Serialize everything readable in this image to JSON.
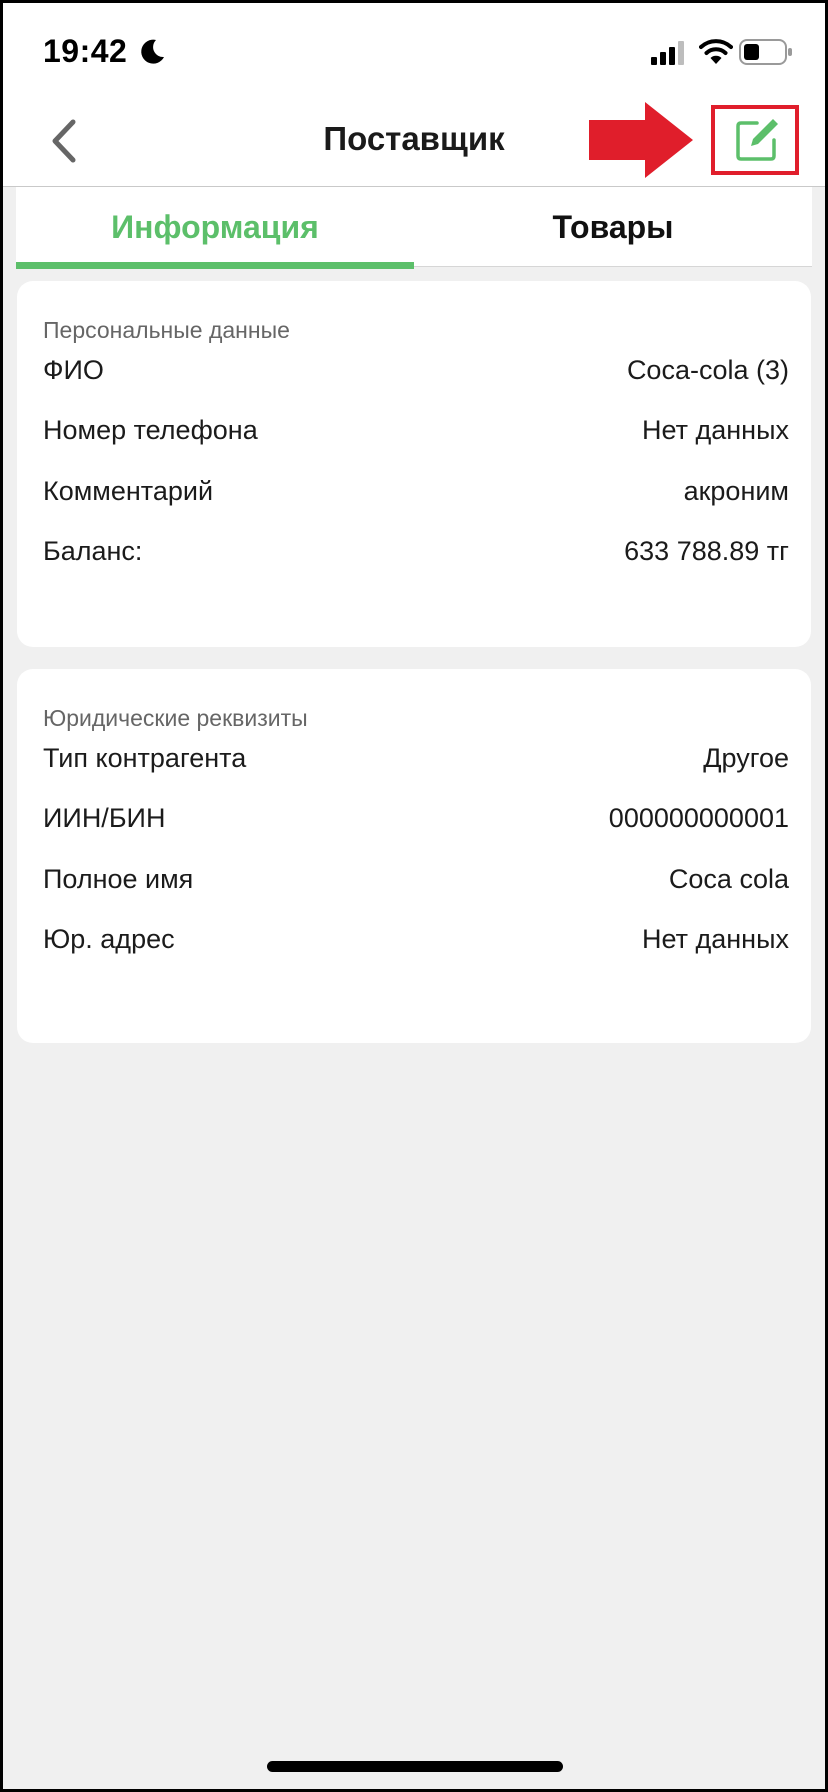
{
  "status_bar": {
    "time": "19:42"
  },
  "nav": {
    "title": "Поставщик",
    "back_icon": "chevron-left-icon",
    "edit_icon": "edit-square-icon"
  },
  "tabs": [
    {
      "label": "Информация",
      "active": true
    },
    {
      "label": "Товары",
      "active": false
    }
  ],
  "personal": {
    "title": "Персональные данные",
    "rows": [
      {
        "label": "ФИО",
        "value": "Coca-cola (3)"
      },
      {
        "label": "Номер телефона",
        "value": "Нет данных"
      },
      {
        "label": "Комментарий",
        "value": "акроним"
      },
      {
        "label": "Баланс:",
        "value": "633 788.89 тг"
      }
    ]
  },
  "legal": {
    "title": "Юридические реквизиты",
    "rows": [
      {
        "label": "Тип контрагента",
        "value": "Другое"
      },
      {
        "label": "ИИН/БИН",
        "value": "000000000001"
      },
      {
        "label": "Полное имя",
        "value": "Coca cola"
      },
      {
        "label": "Юр. адрес",
        "value": "Нет данных"
      }
    ]
  },
  "colors": {
    "accent": "#5cbf6a",
    "annotation_red": "#e01e2b",
    "background": "#f0f0f0"
  }
}
